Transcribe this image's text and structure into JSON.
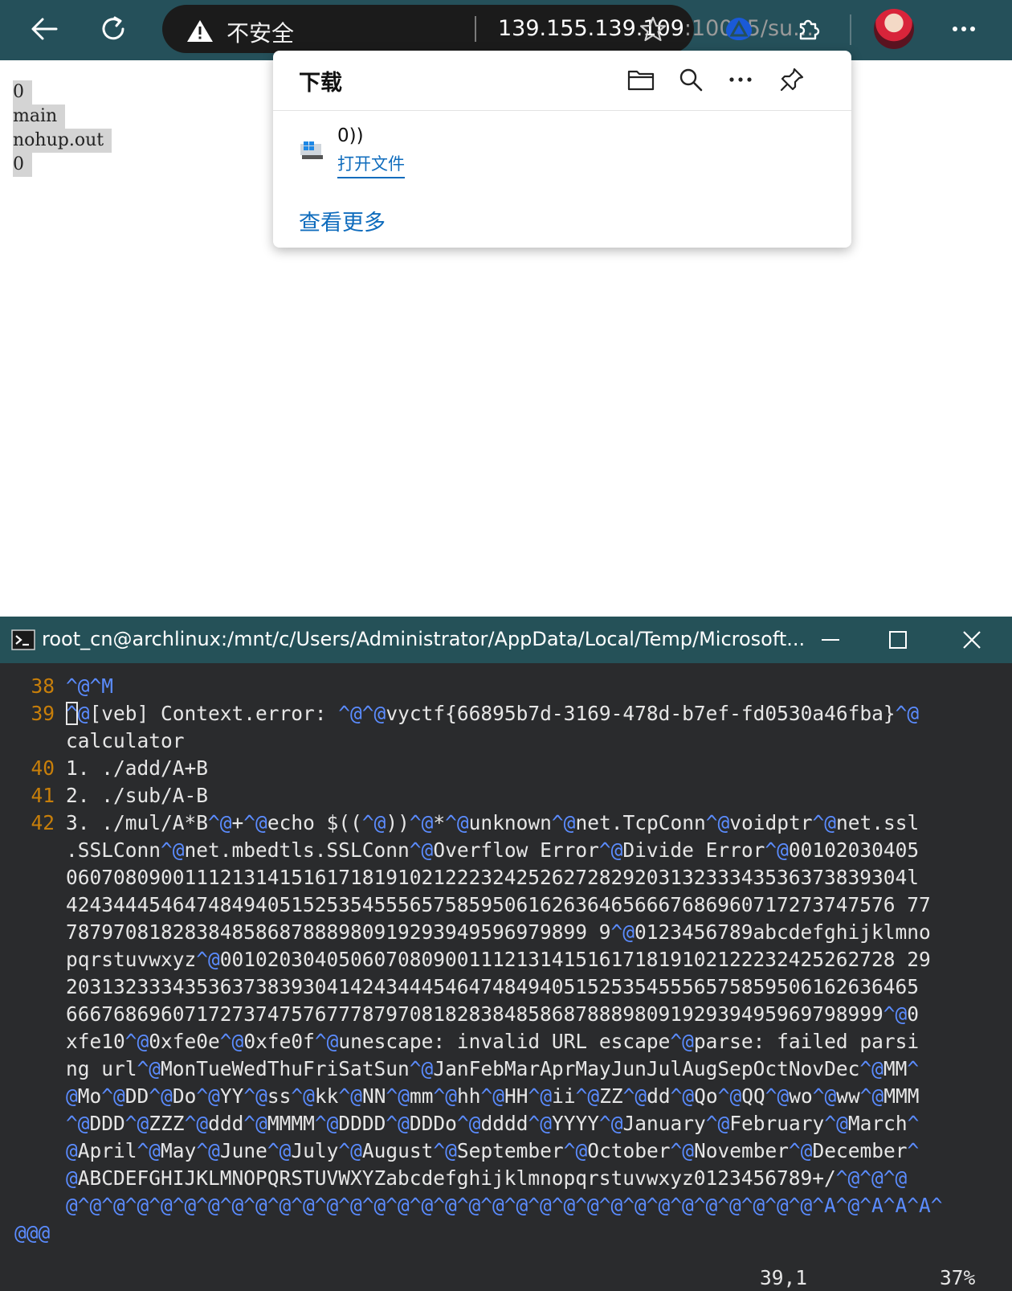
{
  "browser": {
    "address": {
      "security_label": "不安全",
      "host": "139.155.139.109",
      "path": ":10005/su..."
    },
    "icons": [
      "back-arrow-icon",
      "refresh-icon",
      "warning-icon",
      "star-icon",
      "browser-essentials-icon",
      "extensions-icon",
      "profile-avatar",
      "more-icon"
    ]
  },
  "page": {
    "lines": [
      "0",
      "main",
      "nohup.out",
      "0"
    ]
  },
  "downloads": {
    "title": "下载",
    "item": {
      "name": "0))",
      "open_label": "打开文件"
    },
    "see_more": "查看更多"
  },
  "terminal": {
    "title": "root_cn@archlinux:/mnt/c/Users/Administrator/AppData/Local/Temp/Microsoft...",
    "line_numbers": [
      "38",
      "39",
      "40",
      "41",
      "42"
    ],
    "status_position": "39,1",
    "status_percent": "37%",
    "tilde": "@@@",
    "colors": {
      "line_number": "#c87f0a",
      "control_chars": "#5b8cff",
      "text": "#e6e6e6",
      "background": "#2a2b2d",
      "titlebar": "#255158"
    }
  }
}
